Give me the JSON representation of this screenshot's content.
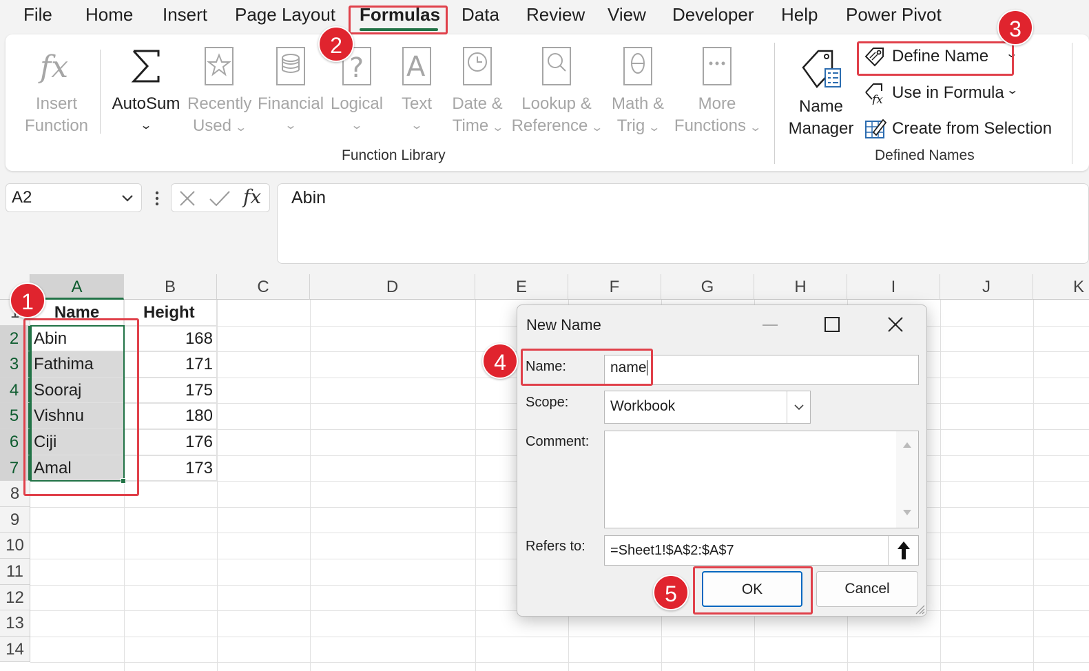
{
  "menu": {
    "tabs": [
      "File",
      "Home",
      "Insert",
      "Page Layout",
      "Formulas",
      "Data",
      "Review",
      "View",
      "Developer",
      "Help",
      "Power Pivot"
    ],
    "active": "Formulas"
  },
  "ribbon": {
    "insert_function": [
      "Insert",
      "Function"
    ],
    "autosum": "AutoSum",
    "recently_used": [
      "Recently",
      "Used"
    ],
    "financial": "Financial",
    "logical": "Logical",
    "text": "Text",
    "date_time": [
      "Date &",
      "Time"
    ],
    "lookup_reference": [
      "Lookup &",
      "Reference"
    ],
    "math_trig": [
      "Math &",
      "Trig"
    ],
    "more_functions": [
      "More",
      "Functions"
    ],
    "function_library_label": "Function Library",
    "name_manager": [
      "Name",
      "Manager"
    ],
    "define_name": "Define Name",
    "use_in_formula": "Use in Formula",
    "create_from_selection": "Create from Selection",
    "defined_names_label": "Defined Names"
  },
  "formula_bar": {
    "name_box": "A2",
    "fx": "fx",
    "value": "Abin"
  },
  "sheet": {
    "columns": [
      "A",
      "B",
      "C",
      "D",
      "E",
      "F",
      "G",
      "H",
      "I",
      "J",
      "K"
    ],
    "rows": [
      "1",
      "2",
      "3",
      "4",
      "5",
      "6",
      "7",
      "8",
      "9",
      "10",
      "11",
      "12",
      "13",
      "14"
    ],
    "header": [
      "Name",
      "Height"
    ],
    "data": [
      [
        "Abin",
        "168"
      ],
      [
        "Fathima",
        "171"
      ],
      [
        "Sooraj",
        "175"
      ],
      [
        "Vishnu",
        "180"
      ],
      [
        "Ciji",
        "176"
      ],
      [
        "Amal",
        "173"
      ]
    ]
  },
  "dialog": {
    "title": "New Name",
    "name_label": "Name:",
    "name_value": "name",
    "scope_label": "Scope:",
    "scope_value": "Workbook",
    "comment_label": "Comment:",
    "refers_label": "Refers to:",
    "refers_value": "=Sheet1!$A$2:$A$7",
    "ok": "OK",
    "cancel": "Cancel"
  },
  "annotations": [
    "1",
    "2",
    "3",
    "4",
    "5"
  ],
  "colors": {
    "accent_green": "#217346",
    "annotation_red": "#e0404a",
    "badge_red": "#e0242e",
    "ok_border_blue": "#0067c0"
  }
}
